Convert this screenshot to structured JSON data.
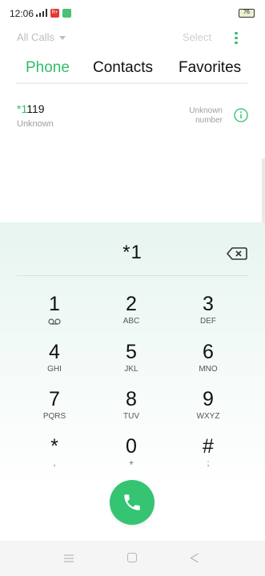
{
  "status_bar": {
    "time": "12:06",
    "battery": "76",
    "notification_badge": "R+"
  },
  "top_bar": {
    "filter_label": "All Calls",
    "select_label": "Select"
  },
  "tabs": [
    {
      "label": "Phone",
      "active": true
    },
    {
      "label": "Contacts",
      "active": false
    },
    {
      "label": "Favorites",
      "active": false
    }
  ],
  "call_log": [
    {
      "number_match": "*1",
      "number_rest": "119",
      "label": "Unknown",
      "type_line1": "Unknown",
      "type_line2": "number"
    }
  ],
  "dialpad": {
    "display": "*1",
    "keys": [
      {
        "digit": "1",
        "letters": ""
      },
      {
        "digit": "2",
        "letters": "ABC"
      },
      {
        "digit": "3",
        "letters": "DEF"
      },
      {
        "digit": "4",
        "letters": "GHI"
      },
      {
        "digit": "5",
        "letters": "JKL"
      },
      {
        "digit": "6",
        "letters": "MNO"
      },
      {
        "digit": "7",
        "letters": "PQRS"
      },
      {
        "digit": "8",
        "letters": "TUV"
      },
      {
        "digit": "9",
        "letters": "WXYZ"
      },
      {
        "digit": "*",
        "letters": ","
      },
      {
        "digit": "0",
        "letters": "+"
      },
      {
        "digit": "#",
        "letters": ";"
      }
    ]
  },
  "colors": {
    "accent": "#2fbd6a",
    "call_button": "#35c472",
    "secondary_text": "#9e9e9e"
  },
  "icons": {
    "voicemail": "voicemail-icon",
    "backspace": "backspace-icon",
    "call": "phone-icon",
    "info": "info-icon",
    "more": "more-vertical-icon"
  }
}
